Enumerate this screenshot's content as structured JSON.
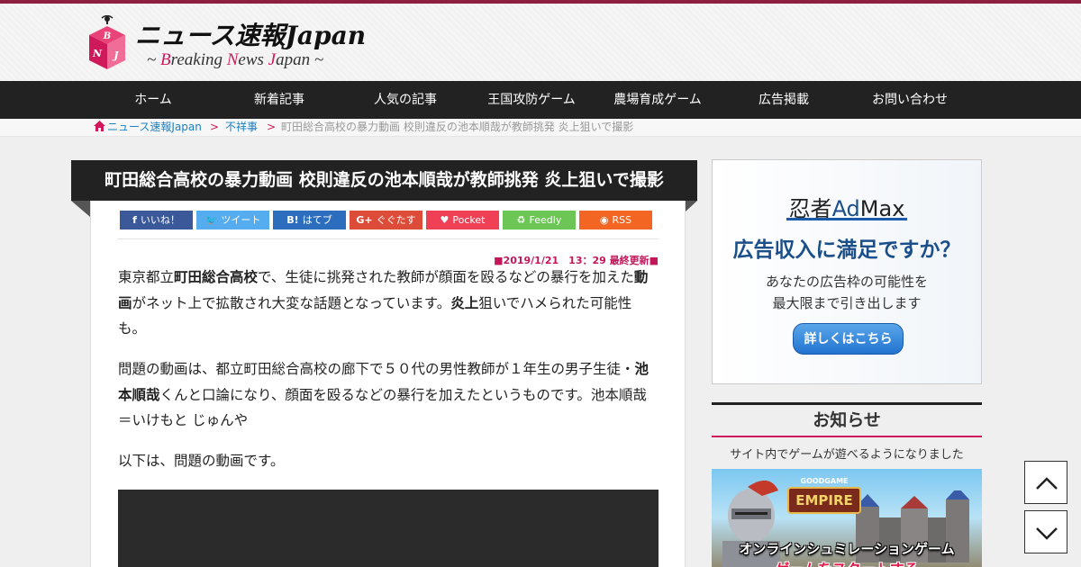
{
  "header": {
    "title": "ニュース速報Japan",
    "subtitle_parts": [
      "~ ",
      "B",
      "reaking ",
      "N",
      "ews ",
      "J",
      "apan ~"
    ],
    "logo_letters": "BNJ",
    "accent": "#d0195b"
  },
  "nav": {
    "items": [
      "ホーム",
      "新着記事",
      "人気の記事",
      "王国攻防ゲーム",
      "農場育成ゲーム",
      "広告掲載",
      "お問い合わせ"
    ]
  },
  "breadcrumb": {
    "home": "ニュース速報Japan",
    "separator": ">",
    "category": "不祥事",
    "current": "町田総合高校の暴力動画 校則違反の池本順哉が教師挑発 炎上狙いで撮影"
  },
  "article": {
    "title": "町田総合高校の暴力動画 校則違反の池本順哉が教師挑発 炎上狙いで撮影",
    "share": [
      {
        "icon": "f",
        "label": "いいね！",
        "color": "#3b5998"
      },
      {
        "icon": "🐦",
        "label": "ツイート",
        "color": "#55acee"
      },
      {
        "icon": "B!",
        "label": "はてブ",
        "color": "#2c6ebd"
      },
      {
        "icon": "G+",
        "label": "ぐぐたす",
        "color": "#dd4b39"
      },
      {
        "icon": "♥",
        "label": "Pocket",
        "color": "#ef4056"
      },
      {
        "icon": "♻",
        "label": "Feedly",
        "color": "#6cc655"
      },
      {
        "icon": "◉",
        "label": "RSS",
        "color": "#f26522"
      }
    ],
    "updated": "■2019/1/21　13：29 最終更新■",
    "p1": [
      "東京都立",
      "町田総合高校",
      "で、生徒に挑発された教師が顔面を殴るなどの暴行を加えた",
      "動画",
      "がネット上で拡散され大変な話題となっています。",
      "炎上",
      "狙いでハメられた可能性も。"
    ],
    "p2": [
      "問題の動画は、都立町田総合高校の廊下で５０代の男性教師が１年生の男子生徒・",
      "池本順哉",
      "くんと口論になり、顔面を殴るなどの暴行を加えたというものです。池本順哉＝いけもと じゅんや"
    ],
    "p3": "以下は、問題の動画です。"
  },
  "sidebar": {
    "ad": {
      "brand_prefix": "忍者",
      "brand_highlight": "Ad",
      "brand_suffix": "Max",
      "headline": "広告収入に満足ですか？",
      "line1": "あなたの広告枠の可能性を",
      "line2": "最大限まで引き出します",
      "button": "詳しくはこちら"
    },
    "notice": {
      "title": "お知らせ",
      "link": "サイト内でゲームが遊べるようになりました"
    },
    "game": {
      "logo_small": "GOODGAME",
      "logo": "EMPIRE",
      "caption1": "オンラインシュミレーションゲーム",
      "caption2": "ゲームをスタートする"
    }
  },
  "icons": {
    "home": "home-icon",
    "scroll_up": "chevron-up-icon",
    "scroll_down": "chevron-down-icon"
  }
}
